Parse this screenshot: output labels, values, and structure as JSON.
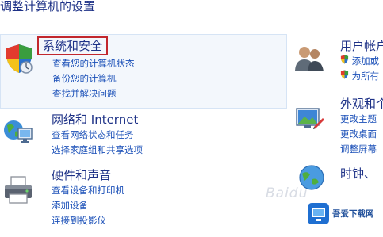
{
  "page": {
    "title": "调整计算机的设置"
  },
  "categories": {
    "system": {
      "title": "系统和安全",
      "links": [
        "查看您的计算机状态",
        "备份您的计算机",
        "查找并解决问题"
      ]
    },
    "network": {
      "title": "网络和 Internet",
      "links": [
        "查看网络状态和任务",
        "选择家庭组和共享选项"
      ]
    },
    "hardware": {
      "title": "硬件和声音",
      "links": [
        "查看设备和打印机",
        "添加设备",
        "连接到投影仪"
      ]
    },
    "users": {
      "title": "用户帐户",
      "links": [
        "添加或",
        "为所有"
      ]
    },
    "appearance": {
      "title": "外观和个",
      "links": [
        "更改主题",
        "更改桌面",
        "调整屏幕"
      ]
    },
    "clock": {
      "title": "时钟、"
    }
  },
  "watermark": {
    "text": "Baidu",
    "logo_text": "吾爱下载网"
  },
  "icons": {
    "system": "shield-icon",
    "network": "network-globe-icon",
    "hardware": "printer-icon",
    "users": "users-icon",
    "appearance": "display-icon",
    "clock": "clock-globe-icon",
    "link_shield": "uac-shield-icon"
  },
  "colors": {
    "title": "#1e3287",
    "link": "#1b50b8",
    "highlight": "#c2272d",
    "panel_bg": "#f3f7fc"
  }
}
